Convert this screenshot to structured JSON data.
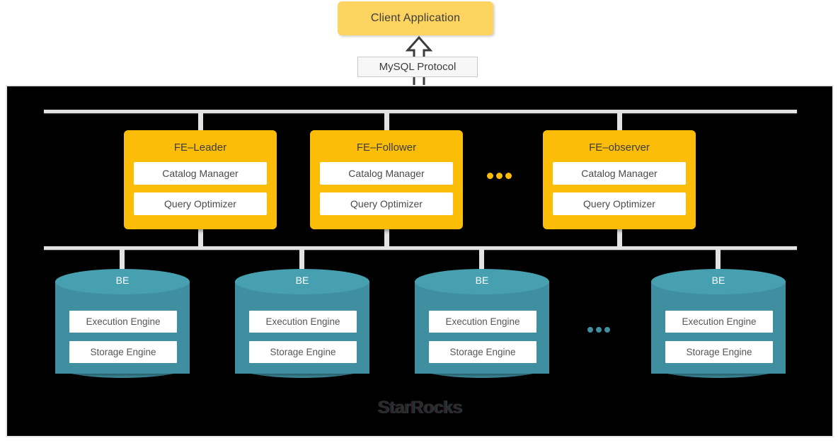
{
  "client": {
    "label": "Client Application",
    "color": "#fcd45f"
  },
  "protocol": {
    "label": "MySQL Protocol",
    "arrow_icon": "double-arrow-vertical-icon",
    "direction": "bidirectional"
  },
  "cluster": {
    "brand": "StarRocks",
    "background": "#000000",
    "fe_layer": {
      "node_color": "#fbbd08",
      "ellipsis": "...",
      "nodes": [
        {
          "title": "FE–Leader",
          "components": [
            "Catalog Manager",
            "Query Optimizer"
          ]
        },
        {
          "title": "FE–Follower",
          "components": [
            "Catalog Manager",
            "Query Optimizer"
          ]
        },
        {
          "title": "FE–observer",
          "components": [
            "Catalog Manager",
            "Query Optimizer"
          ]
        }
      ]
    },
    "be_layer": {
      "node_color": "#3f8fa0",
      "ellipsis": "...",
      "nodes": [
        {
          "title": "BE",
          "components": [
            "Execution Engine",
            "Storage Engine"
          ]
        },
        {
          "title": "BE",
          "components": [
            "Execution Engine",
            "Storage Engine"
          ]
        },
        {
          "title": "BE",
          "components": [
            "Execution Engine",
            "Storage Engine"
          ]
        },
        {
          "title": "BE",
          "components": [
            "Execution Engine",
            "Storage Engine"
          ]
        }
      ]
    }
  }
}
